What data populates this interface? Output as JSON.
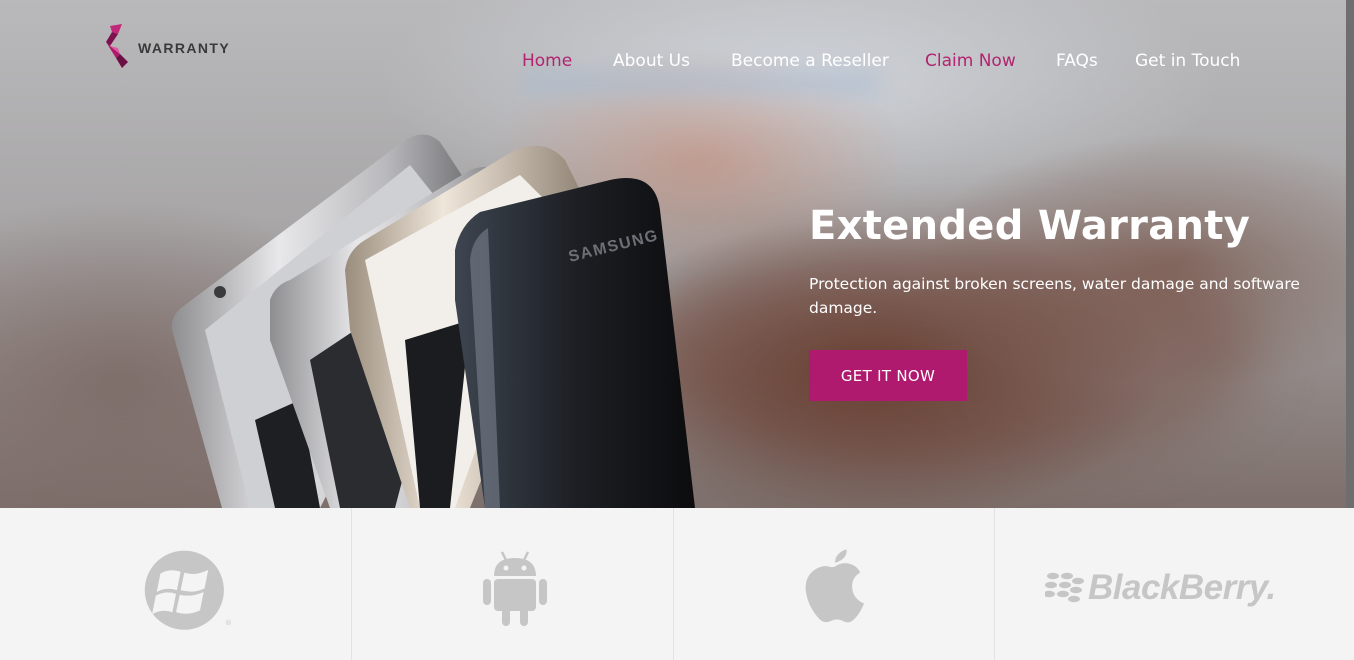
{
  "logo": {
    "text": "WARRANTY",
    "brand_color": "#b01a6e"
  },
  "nav": {
    "items": [
      {
        "label": "Home",
        "color": "#b3236f"
      },
      {
        "label": "About Us",
        "color": "#ffffff"
      },
      {
        "label": "Become a Reseller",
        "color": "#ffffff"
      },
      {
        "label": "Claim Now",
        "color": "#b3236f"
      },
      {
        "label": "FAQs",
        "color": "#ffffff"
      },
      {
        "label": "Get in Touch",
        "color": "#ffffff"
      }
    ]
  },
  "hero": {
    "title": "Extended Warranty",
    "subtitle": "Protection against broken screens, water damage and software damage.",
    "cta_label": "GET IT NOW",
    "cta_color": "#b01a6e",
    "phone_brand": "SAMSUNG"
  },
  "platforms": {
    "items": [
      {
        "name": "windows",
        "icon": "windows-logo-icon"
      },
      {
        "name": "android",
        "icon": "android-robot-icon"
      },
      {
        "name": "apple",
        "icon": "apple-logo-icon"
      },
      {
        "name": "blackberry",
        "icon": "blackberry-logo-icon",
        "wordmark": "BlackBerry."
      }
    ],
    "icon_color": "#c6c6c6"
  }
}
